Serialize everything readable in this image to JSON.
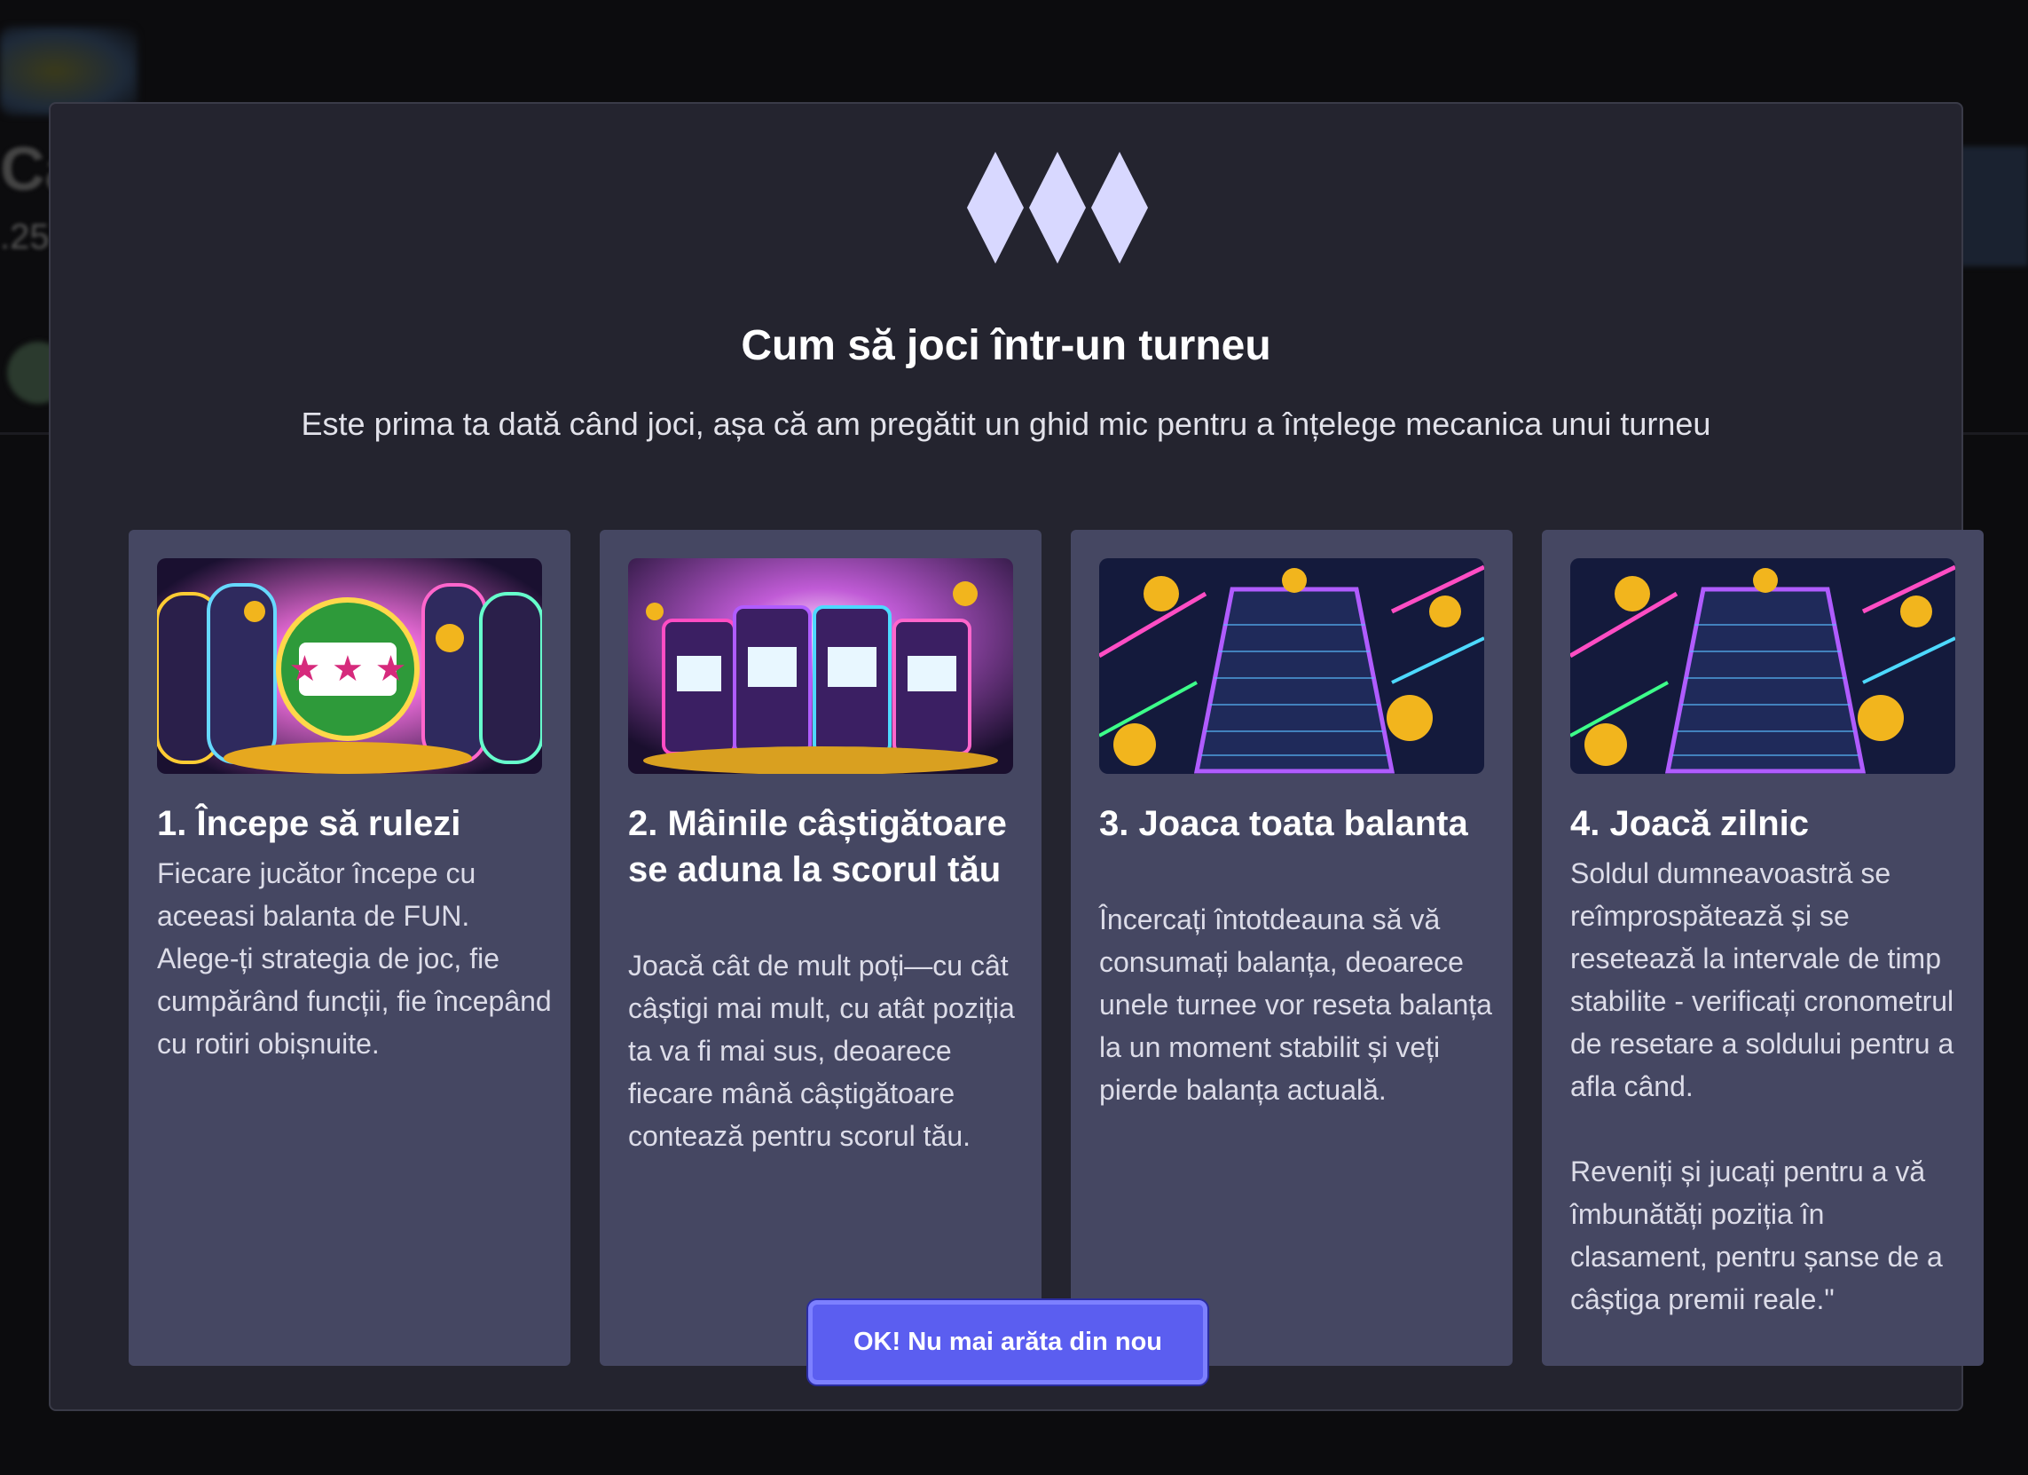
{
  "modal": {
    "title": "Cum să joci într-un turneu",
    "subtitle": "Este prima ta dată când joci, așa că am pregătit un ghid mic pentru a înțelege mecanica unui turneu",
    "cards": [
      {
        "title": "1. Începe să rulezi",
        "text": "Fiecare jucător începe cu aceeasi balanta de FUN. Alege-ți strategia de joc, fie cumpărând funcții, fie începând cu rotiri obișnuite."
      },
      {
        "title": "2. Mâinile câștigătoare se aduna la scorul tău",
        "text": "Joacă cât de mult poți—cu cât câștigi mai mult, cu atât poziția ta va fi mai sus, deoarece fiecare mână câștigătoare contează pentru scorul tău."
      },
      {
        "title": "3. Joaca toata balanta",
        "text": "Încercați întotdeauna să vă consumați balanța, deoarece unele turnee vor reseta balanța la un moment stabilit și veți pierde balanța actuală."
      },
      {
        "title": "4. Joacă zilnic",
        "text": "Soldul dumneavoastră se reîmprospătează și se resetează la intervale de timp stabilite - verificați cronometrul de resetare a soldului pentru a afla când.\n\nReveniți și jucați pentru a vă îmbunătăți poziția în clasament, pentru șanse de a câștiga premii reale.\""
      }
    ],
    "button_label": "OK! Nu mai arăta din nou"
  },
  "background": {
    "title_fragment": "Ca",
    "sub_fragment": ".25"
  },
  "colors": {
    "modal_bg": "#24242f",
    "card_bg": "#454762",
    "button_bg": "#5b5ef0",
    "logo": "#d8d8ff"
  }
}
